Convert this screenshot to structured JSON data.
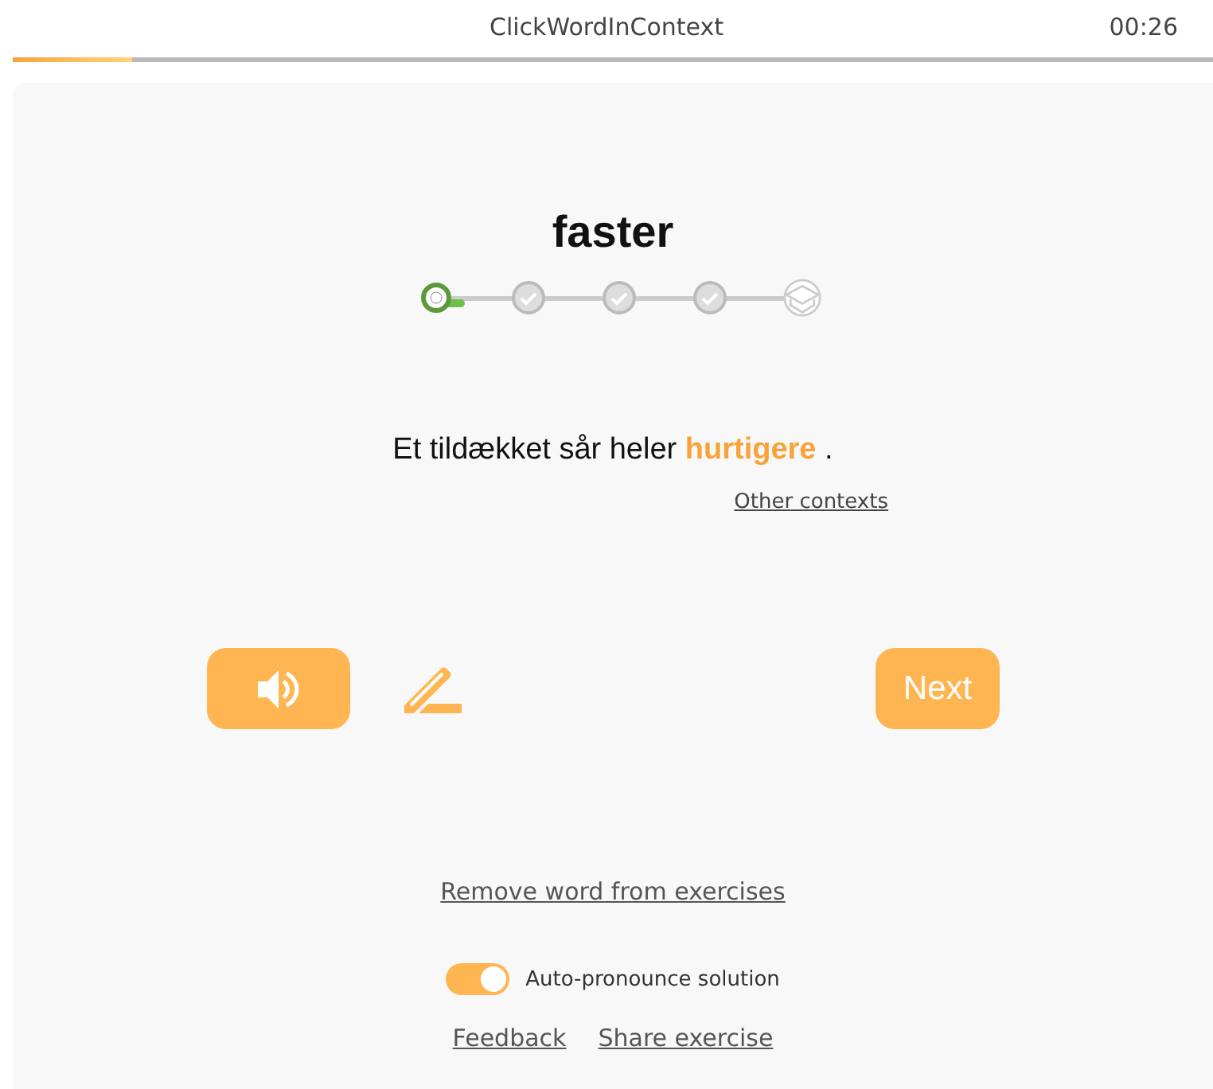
{
  "header": {
    "title": "ClickWordInContext",
    "timer": "00:26",
    "progress": {
      "level": 0.1
    }
  },
  "word": "faster",
  "steps": [
    {
      "kind": "current"
    },
    {
      "kind": "done"
    },
    {
      "kind": "done"
    },
    {
      "kind": "done"
    },
    {
      "kind": "goal"
    }
  ],
  "sentence": {
    "before": "Et tildækket sår heler",
    "target": "hurtigere",
    "after": "."
  },
  "other_contexts": "Other contexts",
  "next_button": "Next",
  "remove_link": "Remove word from exercises",
  "auto_pronounce": {
    "label": "Auto-pronounce solution",
    "on": true
  },
  "footer_links": [
    "Feedback",
    "Share exercise"
  ]
}
